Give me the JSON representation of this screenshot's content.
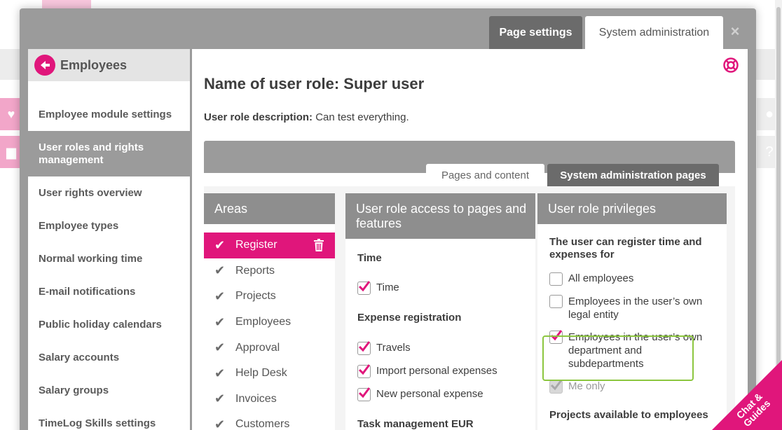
{
  "window": {
    "top_tabs": [
      {
        "label": "Page settings",
        "active": false
      },
      {
        "label": "System administration",
        "active": true
      }
    ],
    "close_symbol": "×"
  },
  "sidebar": {
    "title": "Employees",
    "items": [
      {
        "label": "Employee module settings"
      },
      {
        "label": "User roles and rights management",
        "active": true
      },
      {
        "label": "User rights overview"
      },
      {
        "label": "Employee types"
      },
      {
        "label": "Normal working time"
      },
      {
        "label": "E-mail notifications"
      },
      {
        "label": "Public holiday calendars"
      },
      {
        "label": "Salary accounts"
      },
      {
        "label": "Salary groups"
      },
      {
        "label": "TimeLog Skills settings"
      }
    ]
  },
  "main": {
    "title": "Name of user role: Super user",
    "description_label": "User role description:",
    "description_value": "Can test everything.",
    "sub_tabs": [
      {
        "label": "Pages and content",
        "active": true
      },
      {
        "label": "System administration pages",
        "active": false
      }
    ]
  },
  "areas": {
    "header": "Areas",
    "items": [
      {
        "label": "Register",
        "active": true
      },
      {
        "label": "Reports"
      },
      {
        "label": "Projects"
      },
      {
        "label": "Employees"
      },
      {
        "label": "Approval"
      },
      {
        "label": "Help Desk"
      },
      {
        "label": "Invoices"
      },
      {
        "label": "Customers"
      }
    ]
  },
  "access": {
    "header": "User role access to pages and features",
    "sections": [
      {
        "title": "Time",
        "items": [
          {
            "label": "Time",
            "checked": true
          }
        ]
      },
      {
        "title": "Expense registration",
        "items": [
          {
            "label": "Travels",
            "checked": true
          },
          {
            "label": "Import personal expenses",
            "checked": true
          },
          {
            "label": "New personal expense",
            "checked": true
          }
        ]
      },
      {
        "title": "Task management EUR",
        "items": []
      }
    ]
  },
  "privileges": {
    "header": "User role privileges",
    "section1_title": "The user can register time and expenses for",
    "options": [
      {
        "label": "All employees",
        "checked": false
      },
      {
        "label": "Employees in the user’s own legal entity",
        "checked": false
      },
      {
        "label": "Employees in the user’s own department and subdepartments",
        "checked": true
      },
      {
        "label": "Me only",
        "checked": true,
        "disabled": true
      }
    ],
    "section2_title": "Projects available to employees"
  },
  "chat": {
    "line1": "Chat &",
    "line2": "Guides"
  },
  "colors": {
    "accent": "#e0167b",
    "highlight": "#8cc63f",
    "header_gray": "#8e8e8e"
  }
}
